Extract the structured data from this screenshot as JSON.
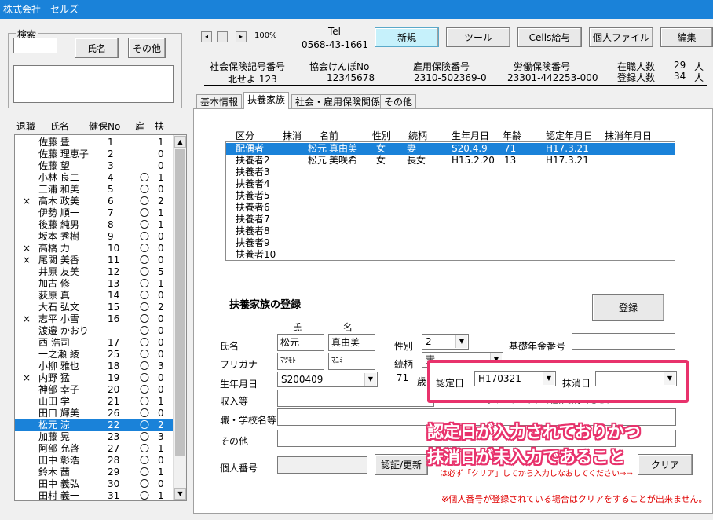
{
  "window": {
    "title": "株式会社　セルズ"
  },
  "search": {
    "legend": "検索",
    "name_button": "氏名",
    "other_button": "その他",
    "input_value": "",
    "memo_value": ""
  },
  "list": {
    "headers": {
      "retired": "退職",
      "name": "氏名",
      "health_no": "健保No",
      "employed": "雇",
      "dependents": "扶"
    },
    "rows": [
      {
        "retired": "",
        "name": "佐藤 豊",
        "no": "1",
        "emp": "",
        "dep": "1"
      },
      {
        "retired": "",
        "name": "佐藤 理恵子",
        "no": "2",
        "emp": "",
        "dep": "0"
      },
      {
        "retired": "",
        "name": "佐藤 望",
        "no": "3",
        "emp": "",
        "dep": "0"
      },
      {
        "retired": "",
        "name": "小林 良二",
        "no": "4",
        "emp": "〇",
        "dep": "1"
      },
      {
        "retired": "",
        "name": "三浦 和美",
        "no": "5",
        "emp": "〇",
        "dep": "0"
      },
      {
        "retired": "×",
        "name": "高木 政美",
        "no": "6",
        "emp": "〇",
        "dep": "2"
      },
      {
        "retired": "",
        "name": "伊勢 順一",
        "no": "7",
        "emp": "〇",
        "dep": "1"
      },
      {
        "retired": "",
        "name": "後藤 純男",
        "no": "8",
        "emp": "〇",
        "dep": "1"
      },
      {
        "retired": "",
        "name": "坂本 秀樹",
        "no": "9",
        "emp": "〇",
        "dep": "0"
      },
      {
        "retired": "×",
        "name": "高橋 力",
        "no": "10",
        "emp": "〇",
        "dep": "0"
      },
      {
        "retired": "×",
        "name": "尾関 美香",
        "no": "11",
        "emp": "〇",
        "dep": "0"
      },
      {
        "retired": "",
        "name": "井原 友美",
        "no": "12",
        "emp": "〇",
        "dep": "5"
      },
      {
        "retired": "",
        "name": "加古 修",
        "no": "13",
        "emp": "〇",
        "dep": "1"
      },
      {
        "retired": "",
        "name": "荻原 真一",
        "no": "14",
        "emp": "〇",
        "dep": "0"
      },
      {
        "retired": "",
        "name": "大石 弘文",
        "no": "15",
        "emp": "〇",
        "dep": "2"
      },
      {
        "retired": "×",
        "name": "志平 小雪",
        "no": "16",
        "emp": "〇",
        "dep": "0"
      },
      {
        "retired": "",
        "name": "渡邉 かおり",
        "no": "",
        "emp": "〇",
        "dep": "0"
      },
      {
        "retired": "",
        "name": "西 浩司",
        "no": "17",
        "emp": "〇",
        "dep": "0"
      },
      {
        "retired": "",
        "name": "一之瀬 綾",
        "no": "25",
        "emp": "〇",
        "dep": "0"
      },
      {
        "retired": "",
        "name": "小柳 雅也",
        "no": "18",
        "emp": "〇",
        "dep": "3"
      },
      {
        "retired": "×",
        "name": "内野 猛",
        "no": "19",
        "emp": "〇",
        "dep": "0"
      },
      {
        "retired": "",
        "name": "神部 幸子",
        "no": "20",
        "emp": "〇",
        "dep": "0"
      },
      {
        "retired": "",
        "name": "山田 学",
        "no": "21",
        "emp": "〇",
        "dep": "1"
      },
      {
        "retired": "",
        "name": "田口 輝美",
        "no": "26",
        "emp": "〇",
        "dep": "0"
      },
      {
        "retired": "",
        "name": "松元 涼",
        "no": "22",
        "emp": "〇",
        "dep": "2"
      },
      {
        "retired": "",
        "name": "加藤 晃",
        "no": "23",
        "emp": "〇",
        "dep": "3"
      },
      {
        "retired": "",
        "name": "阿部 允啓",
        "no": "27",
        "emp": "〇",
        "dep": "1"
      },
      {
        "retired": "",
        "name": "田中 彰浩",
        "no": "28",
        "emp": "〇",
        "dep": "0"
      },
      {
        "retired": "",
        "name": "鈴木 茜",
        "no": "29",
        "emp": "〇",
        "dep": "1"
      },
      {
        "retired": "",
        "name": "田中 義弘",
        "no": "30",
        "emp": "〇",
        "dep": "0"
      },
      {
        "retired": "",
        "name": "田村 義一",
        "no": "31",
        "emp": "〇",
        "dep": "1"
      }
    ],
    "selected_index": 24
  },
  "toolbar": {
    "zoom": "100%",
    "tel_label": "Tel",
    "tel": "0568-43-1661",
    "new_button": "新規",
    "tool_button": "ツール",
    "cells_button": "Cells給与",
    "personal_file_button": "個人ファイル",
    "edit_button": "編集"
  },
  "info": {
    "social_label": "社会保険記号番号",
    "social_value": "北せよ 123",
    "kenpo_label": "協会けんぽNo",
    "kenpo_value": "12345678",
    "employment_label": "雇用保険番号",
    "employment_value": "2310-502369-0",
    "labor_label": "労働保険番号",
    "labor_value": "23301-442253-000",
    "enrolled_label": "在職人数",
    "enrolled_value": "29",
    "registered_label": "登録人数",
    "registered_value": "34",
    "person_unit": "人"
  },
  "tabs": [
    "基本情報",
    "扶養家族",
    "社会・雇用保険関係",
    "その他"
  ],
  "family": {
    "headers": [
      "区分",
      "抹消",
      "名前",
      "性別",
      "続柄",
      "生年月日",
      "年齢",
      "認定年月日",
      "抹消年月日"
    ],
    "rows": [
      {
        "kubun": "配偶者",
        "masho": "",
        "sei": "松元",
        "mei": "真由美",
        "sex": "女",
        "rel": "妻",
        "birth": "S20.4.9",
        "age": "71",
        "nintei": "H17.3.21",
        "mdate": ""
      },
      {
        "kubun": "扶養者2",
        "masho": "",
        "sei": "松元",
        "mei": "美咲希",
        "sex": "女",
        "rel": "長女",
        "birth": "H15.2.20",
        "age": "13",
        "nintei": "H17.3.21",
        "mdate": ""
      },
      {
        "kubun": "扶養者3",
        "masho": "",
        "sei": "",
        "mei": "",
        "sex": "",
        "rel": "",
        "birth": "",
        "age": "",
        "nintei": "",
        "mdate": ""
      },
      {
        "kubun": "扶養者4",
        "masho": "",
        "sei": "",
        "mei": "",
        "sex": "",
        "rel": "",
        "birth": "",
        "age": "",
        "nintei": "",
        "mdate": ""
      },
      {
        "kubun": "扶養者5",
        "masho": "",
        "sei": "",
        "mei": "",
        "sex": "",
        "rel": "",
        "birth": "",
        "age": "",
        "nintei": "",
        "mdate": ""
      },
      {
        "kubun": "扶養者6",
        "masho": "",
        "sei": "",
        "mei": "",
        "sex": "",
        "rel": "",
        "birth": "",
        "age": "",
        "nintei": "",
        "mdate": ""
      },
      {
        "kubun": "扶養者7",
        "masho": "",
        "sei": "",
        "mei": "",
        "sex": "",
        "rel": "",
        "birth": "",
        "age": "",
        "nintei": "",
        "mdate": ""
      },
      {
        "kubun": "扶養者8",
        "masho": "",
        "sei": "",
        "mei": "",
        "sex": "",
        "rel": "",
        "birth": "",
        "age": "",
        "nintei": "",
        "mdate": ""
      },
      {
        "kubun": "扶養者9",
        "masho": "",
        "sei": "",
        "mei": "",
        "sex": "",
        "rel": "",
        "birth": "",
        "age": "",
        "nintei": "",
        "mdate": ""
      },
      {
        "kubun": "扶養者10",
        "masho": "",
        "sei": "",
        "mei": "",
        "sex": "",
        "rel": "",
        "birth": "",
        "age": "",
        "nintei": "",
        "mdate": ""
      }
    ],
    "selected_index": 0
  },
  "form": {
    "title": "扶養家族の登録",
    "register_button": "登録",
    "sei_header": "氏",
    "mei_header": "名",
    "name_label": "氏名",
    "sei_value": "松元",
    "mei_value": "真由美",
    "furigana_label": "フリガナ",
    "furi_sei": "ﾏﾂﾓﾄ",
    "furi_mei": "ﾏﾕﾐ",
    "sex_label": "性別",
    "sex_value": "2",
    "pension_label": "基礎年金番号",
    "pension_value": "",
    "relation_label": "続柄",
    "relation_value": "妻",
    "birth_label": "生年月日",
    "birth_value": "S200409",
    "age_value": "71",
    "age_unit": "歳",
    "nintei_label": "認定日",
    "nintei_value": "H170321",
    "masho_label": "抹消日",
    "masho_value": "",
    "income_label": "収入等",
    "job_label": "職・学校名等",
    "other_label": "その他",
    "mynumber_label": "個人番号",
    "verify_button": "認証/更新",
    "clear_button": "クリア",
    "hint_dblclick": "↑ダブルクリックで社保取得日をセット",
    "hint_clear": "は必ず「クリア」してから入力しなおしてください⇒⇒",
    "note_mynumber": "※個人番号が登録されている場合はクリアをすることが出来ません。"
  },
  "annotation": {
    "line1": "認定日が入力されておりかつ",
    "line2": "抹消日が未入力であること",
    "color": "#e8326c"
  }
}
